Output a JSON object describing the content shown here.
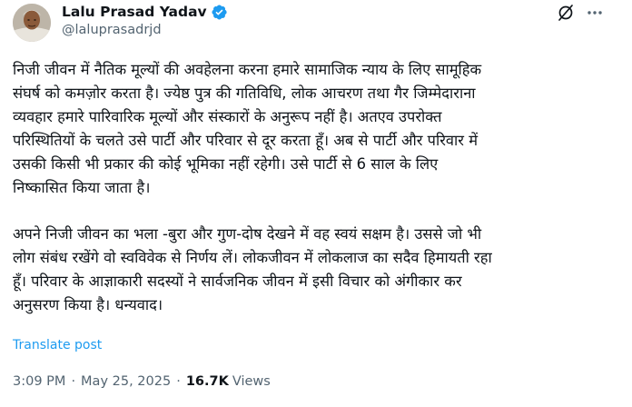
{
  "author": {
    "display_name": "Lalu Prasad Yadav",
    "handle": "@laluprasadrjd",
    "verified_color": "#1d9bf0"
  },
  "icons": {
    "verified": "verified-badge-icon",
    "grok": "grok-icon",
    "more": "more-options-icon"
  },
  "tweet": {
    "paragraphs": [
      "निजी जीवन में नैतिक मूल्यों की अवहेलना करना हमारे सामाजिक न्याय के लिए सामूहिक\nसंघर्ष को कमज़ोर करता है। ज्येष्ठ पुत्र की गतिविधि, लोक आचरण तथा गैर जिम्मेदाराना\nव्यवहार हमारे पारिवारिक मूल्यों और संस्कारों के अनुरूप नहीं है। अतएव उपरोक्त\nपरिस्थितियों के चलते उसे पार्टी और परिवार से दूर करता हूँ। अब से पार्टी और परिवार में\nउसकी किसी भी प्रकार की कोई भूमिका नहीं रहेगी। उसे पार्टी से 6 साल के लिए\nनिष्कासित किया जाता है।",
      "अपने निजी जीवन का भला -बुरा और गुण-दोष देखने में वह स्वयं सक्षम है। उससे जो भी\nलोग संबंध रखेंगे वो स्वविवेक से निर्णय लें। लोकजीवन में लोकलाज का सदैव हिमायती रहा\nहूँ। परिवार के आज्ञाकारी सदस्यों ने सार्वजनिक जीवन में इसी विचार को अंगीकार कर\nअनुसरण किया है। धन्यवाद।"
    ],
    "translate_label": "Translate post",
    "time": "3:09 PM",
    "date": "May 25, 2025",
    "separator": "·",
    "views_count": "16.7K",
    "views_label": "Views"
  },
  "colors": {
    "text": "#0f1419",
    "secondary": "#536471",
    "link": "#1d9bf0"
  }
}
